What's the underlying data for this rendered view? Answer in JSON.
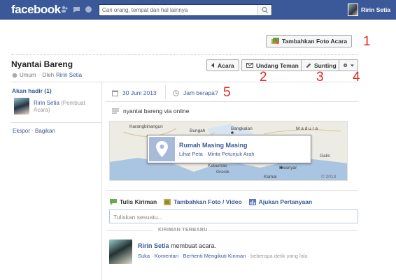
{
  "topbar": {
    "logo": "facebook",
    "search_placeholder": "Cari orang, tempat dan hal lainnya",
    "user_name": "Ririn Setia"
  },
  "actions": {
    "add_photo": "Tambahkan Foto Acara",
    "events": "Acara",
    "invite": "Undang Teman",
    "edit": "Sunting"
  },
  "annotations": [
    "1",
    "2",
    "3",
    "4",
    "5"
  ],
  "event": {
    "title": "Nyantai Bareng",
    "privacy": "Umum",
    "by_prefix": "Oleh",
    "host": "Ririn Setia",
    "date": "30 Juni 2013",
    "time_link": "Jam berapa?",
    "description": "nyantai bareng via online"
  },
  "sidebar": {
    "going_label": "Akan hadir (1)",
    "guest_name": "Ririn Setia",
    "guest_note": "(Pembuat Acara)",
    "export": "Ekspor",
    "share": "Bagikan"
  },
  "map": {
    "place_name": "Rumah Masing Masing",
    "view_map": "Lihat Peta",
    "directions": "Minta Petunjuk Arah",
    "labels": [
      "Karangbinangun",
      "Bungah",
      "Bangkalan",
      "M a d u r a",
      "Galis",
      "Kebomas",
      "Gresik",
      "Kwanyar",
      "Kamal"
    ],
    "copyright": "© 2013 Nokia"
  },
  "composer": {
    "tab_post": "Tulis Kiriman",
    "tab_photo": "Tambahkan Foto / Video",
    "tab_question": "Ajukan Pertanyaan",
    "placeholder": "Tuliskan sesuatu..."
  },
  "feed": {
    "section_label": "KIRIMAN TERBARU",
    "author": "Ririn Setia",
    "action": "membuat acara.",
    "like": "Suka",
    "comment": "Komentari",
    "unfollow": "Berhenti Mengikuti Kiriman",
    "time": "beberapa detik yang lalu"
  },
  "colors": {
    "brand": "#3b5998",
    "annotation": "#e02a24"
  }
}
